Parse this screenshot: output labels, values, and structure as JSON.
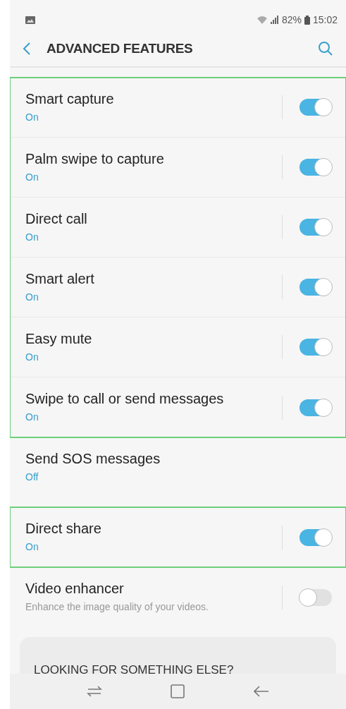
{
  "status_bar": {
    "battery": "82%",
    "time": "15:02"
  },
  "header": {
    "title": "ADVANCED FEATURES"
  },
  "groups": [
    {
      "highlighted": true,
      "items": [
        {
          "kind": "toggle",
          "title": "Smart capture",
          "status": "On",
          "on": true
        },
        {
          "kind": "toggle",
          "title": "Palm swipe to capture",
          "status": "On",
          "on": true
        },
        {
          "kind": "toggle",
          "title": "Direct call",
          "status": "On",
          "on": true
        },
        {
          "kind": "toggle",
          "title": "Smart alert",
          "status": "On",
          "on": true
        },
        {
          "kind": "toggle",
          "title": "Easy mute",
          "status": "On",
          "on": true
        },
        {
          "kind": "toggle",
          "title": "Swipe to call or send messages",
          "status": "On",
          "on": true
        }
      ]
    },
    {
      "highlighted": false,
      "items": [
        {
          "kind": "plain",
          "title": "Send SOS messages",
          "status": "Off"
        }
      ]
    },
    {
      "highlighted": true,
      "items": [
        {
          "kind": "toggle",
          "title": "Direct share",
          "status": "On",
          "on": true
        }
      ]
    },
    {
      "highlighted": false,
      "items": [
        {
          "kind": "toggle",
          "title": "Video enhancer",
          "description": "Enhance the image quality of your videos.",
          "on": false
        }
      ]
    }
  ],
  "suggestion_card": {
    "title": "LOOKING FOR SOMETHING ELSE?"
  }
}
